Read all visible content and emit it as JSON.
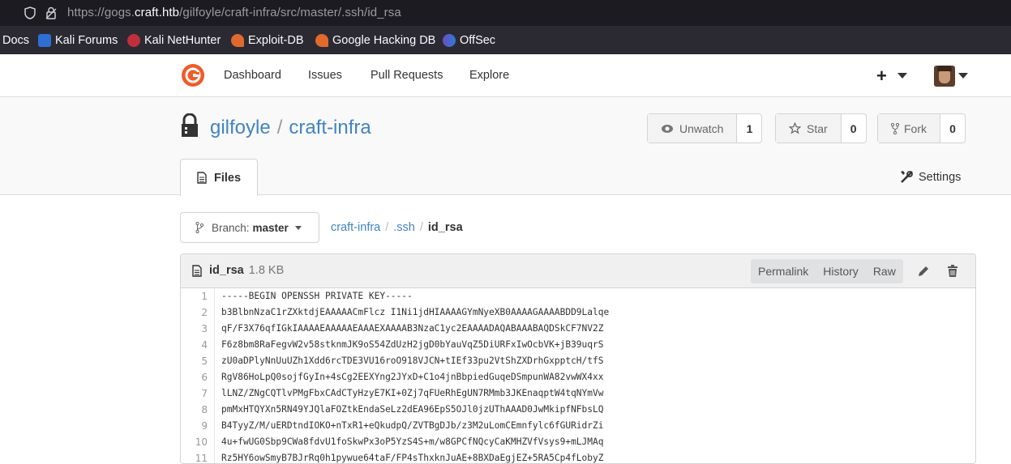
{
  "browser": {
    "url_prefix": "https://gogs.",
    "url_host": "craft.htb",
    "url_path": "/gilfoyle/craft-infra/src/master/.ssh/id_rsa",
    "bookmarks": [
      {
        "label": "Docs",
        "icon": "none"
      },
      {
        "label": "Kali Forums",
        "icon": "kali-forums-icon"
      },
      {
        "label": "Kali NetHunter",
        "icon": "nethunter-icon"
      },
      {
        "label": "Exploit-DB",
        "icon": "exploitdb-icon"
      },
      {
        "label": "Google Hacking DB",
        "icon": "ghdb-icon"
      },
      {
        "label": "OffSec",
        "icon": "offsec-icon"
      }
    ]
  },
  "nav": {
    "dashboard": "Dashboard",
    "issues": "Issues",
    "pulls": "Pull Requests",
    "explore": "Explore",
    "plus": "+"
  },
  "repo": {
    "owner": "gilfoyle",
    "separator": "/",
    "name": "craft-infra",
    "unwatch_label": "Unwatch",
    "unwatch_count": "1",
    "star_label": "Star",
    "star_count": "0",
    "fork_label": "Fork",
    "fork_count": "0",
    "files_tab": "Files",
    "settings_label": "Settings"
  },
  "branch": {
    "label": "Branch:",
    "value": "master"
  },
  "breadcrumb": {
    "root": "craft-infra",
    "dir": ".ssh",
    "file": "id_rsa"
  },
  "file": {
    "name": "id_rsa",
    "size": "1.8 KB",
    "permalink": "Permalink",
    "history": "History",
    "raw": "Raw",
    "lines": [
      {
        "n": "1",
        "t": "-----BEGIN OPENSSH PRIVATE KEY-----"
      },
      {
        "n": "2",
        "t": "b3BlbnNzaC1rZXktdjEAAAAACmFlcz I1Ni1jdHIAAAAGYmNyeXB0AAAAGAAAABDD9Lalqe"
      },
      {
        "n": "3",
        "t": "qF/F3X76qfIGkIAAAAEAAAAAEAAAEXAAAAB3NzaC1yc2EAAAADAQABAAABAQDSkCF7NV2Z"
      },
      {
        "n": "4",
        "t": "F6z8bm8RaFegvW2v58stknmJK9oS54ZdUzH2jgD0bYauVqZ5DiURFxIwOcbVK+jB39uqrS"
      },
      {
        "n": "5",
        "t": "zU0aDPlyNnUuUZh1Xdd6rcTDE3VU16roO918VJCN+tIEf33pu2VtShZXDrhGxpptcH/tfS"
      },
      {
        "n": "6",
        "t": "RgV86HoLpQ0sojfGyIn+4sCg2EEXYng2JYxD+C1o4jnBbpiedGuqeDSmpunWA82vwWX4xx"
      },
      {
        "n": "7",
        "t": "lLNZ/ZNgCQTlvPMgFbxCAdCTyHzyE7KI+0Zj7qFUeRhEgUN7RMmb3JKEnaqptW4tqNYmVw"
      },
      {
        "n": "8",
        "t": "pmMxHTQYXn5RN49YJQlaFOZtkEndaSeLz2dEA96EpS5OJl0jzUThAAAD0JwMkipfNFbsLQ"
      },
      {
        "n": "9",
        "t": "B4TyyZ/M/uERDtndIOKO+nTxR1+eQkudpQ/ZVTBgDJb/z3M2uLomCEmnfylc6fGURidrZi"
      },
      {
        "n": "10",
        "t": "4u+fwUG0Sbp9CWa8fdvU1foSkwPx3oP5YzS4S+m/w8GPCfNQcyCaKMHZVfVsys9+mLJMAq"
      },
      {
        "n": "11",
        "t": "Rz5HY6owSmyB7BJrRq0h1pywue64taF/FP4sThxknJuAE+8BXDaEgjEZ+5RA5Cp4fLobyZ"
      }
    ]
  },
  "colors": {
    "link": "#4183c4",
    "logo": "#f15a29"
  }
}
